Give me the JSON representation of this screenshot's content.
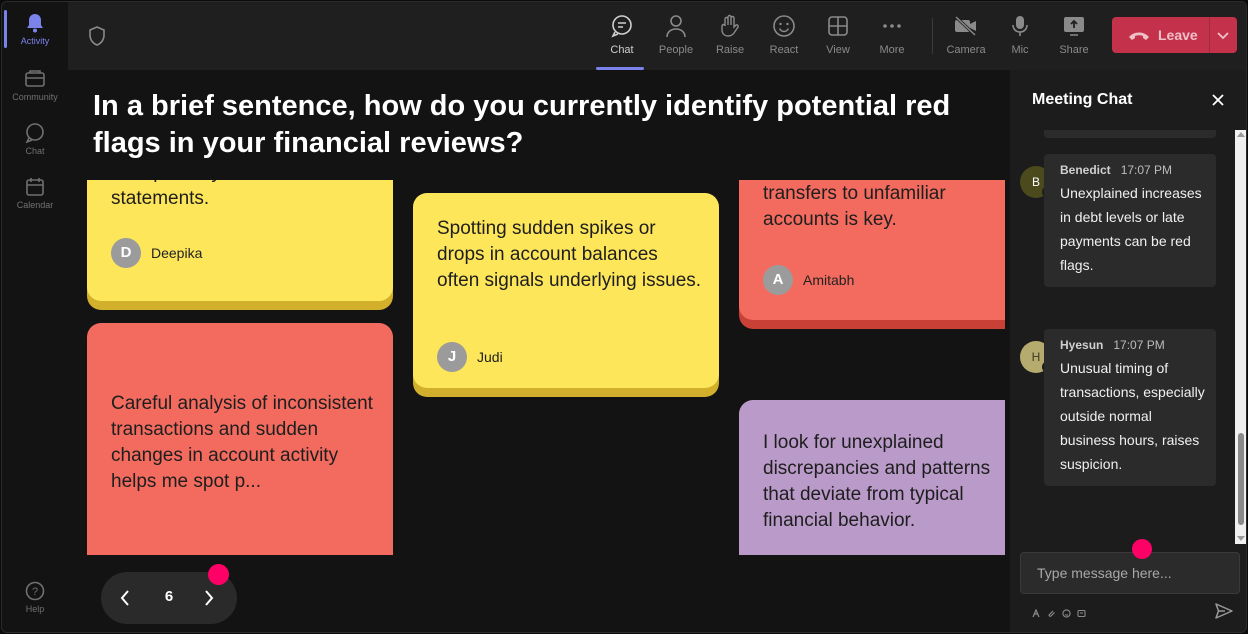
{
  "rail": {
    "items": [
      {
        "label": "Activity",
        "icon": "bell-icon",
        "active": true
      },
      {
        "label": "Community",
        "icon": "community-icon"
      },
      {
        "label": "Chat",
        "icon": "chat-icon"
      },
      {
        "label": "Calendar",
        "icon": "calendar-icon"
      }
    ],
    "help": "Help"
  },
  "toolbar": {
    "chat": "Chat",
    "people": "People",
    "raise": "Raise",
    "react": "React",
    "view": "View",
    "more": "More",
    "camera": "Camera",
    "mic": "Mic",
    "share": "Share",
    "leave": "Leave"
  },
  "question": "In a brief sentence, how do you currently identify potential red flags in your financial reviews?",
  "notes": [
    {
      "text": "transparency in financial statements.",
      "author": "Deepika",
      "initial": "D",
      "color": "yellow"
    },
    {
      "text": "Careful analysis of inconsistent transactions and sudden changes in account activity helps me spot p...",
      "color": "red"
    },
    {
      "text": "Spotting sudden spikes or drops in account balances often signals underlying issues.",
      "author": "Judi",
      "initial": "J",
      "color": "yellow"
    },
    {
      "text": "transfers to unfamiliar accounts is key.",
      "author": "Amitabh",
      "initial": "A",
      "color": "red"
    },
    {
      "text": "I look for unexplained discrepancies and patterns that deviate from typical financial behavior.",
      "color": "purple"
    }
  ],
  "pager": {
    "page": "6"
  },
  "chat": {
    "title": "Meeting Chat",
    "messages": [
      {
        "name": "Benedict",
        "initial": "B",
        "time": "17:07 PM",
        "text": "Unexplained increases in debt levels or late payments can be red flags.",
        "avatar_color": "#4b4a1c",
        "avatar_text_color": "#ffffff"
      },
      {
        "name": "Hyesun",
        "initial": "H",
        "time": "17:07 PM",
        "text": "Unusual timing of transactions, especially outside normal business hours, raises suspicion.",
        "avatar_color": "#b5ab6e",
        "avatar_text_color": "#3a3a22"
      }
    ],
    "input_placeholder": "Type message here..."
  },
  "colors": {
    "accent": "#7b83eb",
    "leave": "#c4314b",
    "note_yellow": "#fde65a",
    "note_red": "#f26b5e",
    "note_purple": "#b99ac9",
    "pink_dot": "#ff0066"
  }
}
